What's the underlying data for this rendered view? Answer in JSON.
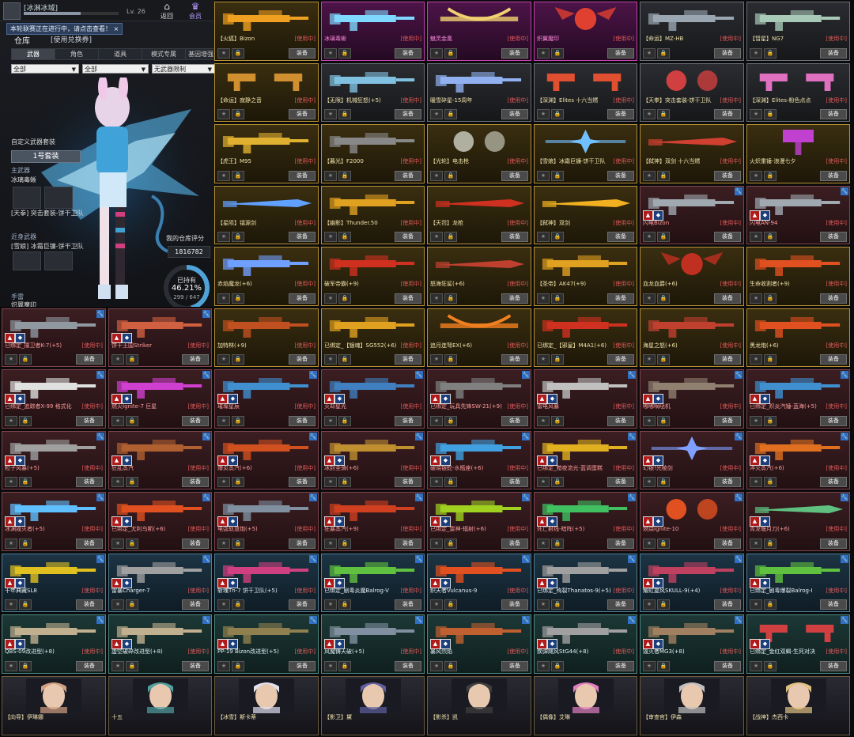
{
  "header": {
    "player_name": "[冰淋冰域]",
    "level": "Lv. 26",
    "back_label": "返回",
    "member_label": "会员",
    "notice": "本轮联赛正在进行中，请点击查看！ ×"
  },
  "warehouse": {
    "title": "仓库",
    "exchange": "[使用兑换券]",
    "tabs": [
      "武器",
      "角色",
      "道具",
      "模式专属",
      "基因增强"
    ],
    "filters": [
      "全部",
      "全部",
      "无武器限制"
    ],
    "custom_set_label": "自定义武器套装",
    "set_button": "1号套装",
    "slots": [
      {
        "slot": "主武器",
        "item": "冰璃毒蜥"
      },
      {
        "slot": "",
        "item": "[天拳] 突击套装-饼干卫队"
      },
      {
        "slot": "近身武器",
        "item": "[雪娘] 冰霜巨镰-饼干卫队"
      },
      {
        "slot": "手雷",
        "item": "炽翼魔印"
      }
    ],
    "score_label": "我的仓库评分",
    "score_value": "1816782",
    "own_label": "已持有",
    "own_percent": 46.21,
    "own_percent_text": "46.21%",
    "own_count": "299 / 647"
  },
  "labels": {
    "using": "[使用中]",
    "equip": "装备",
    "star": "★",
    "lock": "🔒",
    "wrench": "🔧",
    "badge_a": "▲",
    "badge_b": "◆"
  },
  "colors": {
    "gold_frame": "#b89234",
    "pink_frame": "#c540ae",
    "red_frame": "#7e454c",
    "blue_frame": "#4f7f96",
    "teal_frame": "#4d8a82",
    "using_text": "#e35a5a"
  },
  "cards": [
    {
      "name": "【火狐】Bizon",
      "tier": "gold",
      "using": true,
      "shape": "gun",
      "color": "#f0a020"
    },
    {
      "name": "冰璃毒蜥",
      "tier": "pink",
      "using": true,
      "shape": "gun",
      "color": "#7fd8ff"
    },
    {
      "name": "魅灵金凰",
      "tier": "pink",
      "using": true,
      "shape": "bow",
      "color": "#f0d070"
    },
    {
      "name": "炽翼魔印",
      "tier": "pink",
      "using": true,
      "shape": "bug",
      "color": "#e04030"
    },
    {
      "name": "【命运】MZ-HB",
      "tier": "dark",
      "using": true,
      "shape": "gun",
      "color": "#9aa6b2"
    },
    {
      "name": "【彗星】NG7",
      "tier": "dark",
      "using": true,
      "shape": "gun",
      "color": "#a8c8b8"
    },
    {
      "name": "【命运】寂静之音",
      "tier": "gold",
      "using": true,
      "shape": "dual",
      "color": "#d09030"
    },
    {
      "name": "【无限】机械狂怒(+5)",
      "tier": "dark",
      "using": true,
      "shape": "gun",
      "color": "#80c0e0"
    },
    {
      "name": "暖雪碎星-15周年",
      "tier": "dark",
      "using": true,
      "shape": "gun",
      "color": "#90b0f0"
    },
    {
      "name": "【深渊】Elites 十六当燃",
      "tier": "dark",
      "using": true,
      "shape": "dual",
      "color": "#e05030"
    },
    {
      "name": "【天拳】突击套装-饼干卫队",
      "tier": "dark",
      "using": true,
      "shape": "orb",
      "color": "#d04040"
    },
    {
      "name": "【深渊】Elites-粉色点点",
      "tier": "dark",
      "using": true,
      "shape": "dual",
      "color": "#e070c0"
    },
    {
      "name": "【虎王】M95",
      "tier": "gold",
      "using": true,
      "shape": "gun",
      "color": "#e0b030"
    },
    {
      "name": "【暮光】F2000",
      "tier": "gold",
      "using": true,
      "shape": "gun",
      "color": "#888888"
    },
    {
      "name": "【光轮】电击枪",
      "tier": "gold",
      "using": true,
      "shape": "orb",
      "color": "#b0b0a0"
    },
    {
      "name": "【雪娘】冰霜巨镰-饼干卫队",
      "tier": "gold",
      "using": true,
      "shape": "star",
      "color": "#70c0ff"
    },
    {
      "name": "【弑神】双剑 十六当燃",
      "tier": "gold",
      "using": true,
      "shape": "blade",
      "color": "#d04030"
    },
    {
      "name": "火炽重锤-浪漫七夕",
      "tier": "gold",
      "using": true,
      "shape": "hammer",
      "color": "#c040d0"
    },
    {
      "name": "【星陨】镭源剑",
      "tier": "gold",
      "using": true,
      "shape": "blade",
      "color": "#60a0ff"
    },
    {
      "name": "【幽影】Thunder.50",
      "tier": "gold",
      "using": true,
      "shape": "gun",
      "color": "#e0a020"
    },
    {
      "name": "【天罚】龙枪",
      "tier": "gold",
      "using": true,
      "shape": "blade",
      "color": "#d03020"
    },
    {
      "name": "【弑神】双剑",
      "tier": "gold",
      "using": true,
      "shape": "blade",
      "color": "#f0b020"
    },
    {
      "name": "闪电Bizon",
      "tier": "red",
      "using": true,
      "shape": "gun",
      "color": "#a0a8b0"
    },
    {
      "name": "闪电AN-94",
      "tier": "red",
      "using": true,
      "shape": "gun",
      "color": "#a0a8b0"
    },
    {
      "name": "赤焰魔龙(+6)",
      "tier": "gold",
      "using": true,
      "shape": "gun",
      "color": "#70a0ff"
    },
    {
      "name": "破军帝霸(+9)",
      "tier": "gold",
      "using": true,
      "shape": "gun",
      "color": "#d03020"
    },
    {
      "name": "怒海狂鲨(+6)",
      "tier": "gold",
      "using": true,
      "shape": "blade",
      "color": "#c04030"
    },
    {
      "name": "【圣帝】AK47(+9)",
      "tier": "gold",
      "using": true,
      "shape": "gun",
      "color": "#e0a020"
    },
    {
      "name": "血龙血爵(+6)",
      "tier": "gold",
      "using": true,
      "shape": "bug",
      "color": "#c03020"
    },
    {
      "name": "生命收割者(+9)",
      "tier": "gold",
      "using": true,
      "shape": "gun",
      "color": "#e05020"
    },
    {
      "name": "已绑定_撞卫者K-7(+5)",
      "tier": "red",
      "using": true,
      "shape": "gun",
      "color": "#9098a0"
    },
    {
      "name": "饼干王国Striker",
      "tier": "red",
      "using": true,
      "shape": "gun",
      "color": "#d06040"
    },
    {
      "name": "加特林(+9)",
      "tier": "gold",
      "using": true,
      "shape": "gun",
      "color": "#c05020"
    },
    {
      "name": "已绑定_【银魂】SG552(+6)",
      "tier": "gold",
      "using": true,
      "shape": "gun",
      "color": "#e0a020"
    },
    {
      "name": "追月连弩EX(+6)",
      "tier": "gold",
      "using": true,
      "shape": "bow",
      "color": "#f08020"
    },
    {
      "name": "已绑定_【邪皇】M4A1(+6)",
      "tier": "gold",
      "using": true,
      "shape": "gun",
      "color": "#d03020"
    },
    {
      "name": "海星之怒(+6)",
      "tier": "gold",
      "using": true,
      "shape": "gun",
      "color": "#c04030"
    },
    {
      "name": "黑龙炮(+6)",
      "tier": "gold",
      "using": true,
      "shape": "gun",
      "color": "#e05020"
    },
    {
      "name": "已绑定_追踪者X-99 格式化",
      "tier": "red",
      "using": true,
      "shape": "gun",
      "color": "#e0e0e0"
    },
    {
      "name": "燃火Ignite-7 巨星",
      "tier": "red",
      "using": true,
      "shape": "gun",
      "color": "#d040d0"
    },
    {
      "name": "璀璨星辰",
      "tier": "red",
      "using": true,
      "shape": "gun",
      "color": "#4090d0"
    },
    {
      "name": "灭却星光",
      "tier": "red",
      "using": true,
      "shape": "gun",
      "color": "#4080c0"
    },
    {
      "name": "已绑定_玩具先锋SW-21(+9)",
      "tier": "red",
      "using": true,
      "shape": "gun",
      "color": "#808080"
    },
    {
      "name": "雷电风暴",
      "tier": "red",
      "using": true,
      "shape": "gun",
      "color": "#c0c0c0"
    },
    {
      "name": "嘟嘟嘀哒机",
      "tier": "red",
      "using": true,
      "shape": "gun",
      "color": "#908070"
    },
    {
      "name": "已绑定_炽炎汽锤-蓝海(+5)",
      "tier": "red",
      "using": true,
      "shape": "gun",
      "color": "#4090d0"
    },
    {
      "name": "粒子风暴(+5)",
      "tier": "red",
      "using": true,
      "shape": "gun",
      "color": "#a0a0a0"
    },
    {
      "name": "狂乱蒸汽",
      "tier": "red",
      "using": true,
      "shape": "gun",
      "color": "#b06030"
    },
    {
      "name": "爆炎蒸汽(+6)",
      "tier": "red",
      "using": true,
      "shape": "gun",
      "color": "#d05020"
    },
    {
      "name": "冰封圣骑(+6)",
      "tier": "red",
      "using": true,
      "shape": "gun",
      "color": "#c09030"
    },
    {
      "name": "破晓银蛇-水瓶座(+6)",
      "tier": "red",
      "using": true,
      "shape": "gun",
      "color": "#40a0e0"
    },
    {
      "name": "已绑定_黯夜流光-蓝调蛋糕",
      "tier": "red",
      "using": true,
      "shape": "gun",
      "color": "#e0b020"
    },
    {
      "name": "幻银!光棱剑",
      "tier": "red",
      "using": true,
      "shape": "star",
      "color": "#80a0ff"
    },
    {
      "name": "淬火蒸汽(+6)",
      "tier": "red",
      "using": true,
      "shape": "gun",
      "color": "#e07020"
    },
    {
      "name": "冰渊毁灭者(+5)",
      "tier": "red",
      "using": true,
      "shape": "gun",
      "color": "#60c0ff"
    },
    {
      "name": "已绑定_尤利乌斯(+6)",
      "tier": "red",
      "using": true,
      "shape": "gun",
      "color": "#e05020"
    },
    {
      "name": "电弧轨道炮(+5)",
      "tier": "red",
      "using": true,
      "shape": "gun",
      "color": "#8090a0"
    },
    {
      "name": "狂暴蒸汽(+9)",
      "tier": "red",
      "using": true,
      "shape": "gun",
      "color": "#d04020"
    },
    {
      "name": "已绑定_雷神-辐射(+6)",
      "tier": "red",
      "using": true,
      "shape": "gun",
      "color": "#a0d020"
    },
    {
      "name": "死亡射线-暗阵(+5)",
      "tier": "red",
      "using": true,
      "shape": "gun",
      "color": "#40c060"
    },
    {
      "name": "燃烧Ignite-10",
      "tier": "red",
      "using": true,
      "shape": "orb",
      "color": "#e05020"
    },
    {
      "name": "青龙偃月刀(+6)",
      "tier": "red",
      "using": true,
      "shape": "blade",
      "color": "#60c080"
    },
    {
      "name": "十年典藏SL8",
      "tier": "blue",
      "using": true,
      "shape": "gun",
      "color": "#e0c020"
    },
    {
      "name": "雷暴Charger-7",
      "tier": "blue",
      "using": true,
      "shape": "gun",
      "color": "#a0a0a0"
    },
    {
      "name": "斩魂Tn-7 饼干卫队(+5)",
      "tier": "blue",
      "using": true,
      "shape": "gun",
      "color": "#d04080"
    },
    {
      "name": "已绑定_剧毒炎魔Balrog-V",
      "tier": "blue",
      "using": true,
      "shape": "gun",
      "color": "#60c040"
    },
    {
      "name": "织天者Vulcanus-9",
      "tier": "blue",
      "using": true,
      "shape": "gun",
      "color": "#e05020"
    },
    {
      "name": "已绑定_殉裂Thanatos-9(+5)",
      "tier": "blue",
      "using": true,
      "shape": "gun",
      "color": "#a0a0a0"
    },
    {
      "name": "耀虹旋风SKULL-9(+4)",
      "tier": "blue",
      "using": true,
      "shape": "gun",
      "color": "#c04060"
    },
    {
      "name": "已绑定_剧毒爆裂Balrog-I",
      "tier": "blue",
      "using": true,
      "shape": "gun",
      "color": "#60c040"
    },
    {
      "name": "QBS-09改进型(+8)",
      "tier": "teal",
      "using": true,
      "shape": "gun",
      "color": "#c0b090"
    },
    {
      "name": "虚空破碎改进型(+8)",
      "tier": "teal",
      "using": true,
      "shape": "gun",
      "color": "#c0b090"
    },
    {
      "name": "PP-19 Bizon改进型(+5)",
      "tier": "teal",
      "using": true,
      "shape": "gun",
      "color": "#908050"
    },
    {
      "name": "风魔铸天破(+5)",
      "tier": "teal",
      "using": true,
      "shape": "gun",
      "color": "#8090a0"
    },
    {
      "name": "暴风烈焰",
      "tier": "teal",
      "using": true,
      "shape": "gun",
      "color": "#c06030"
    },
    {
      "name": "疾弹飓风StG44(+8)",
      "tier": "teal",
      "using": true,
      "shape": "gun",
      "color": "#a0a0a0"
    },
    {
      "name": "毁灭者MG3(+8)",
      "tier": "teal",
      "using": true,
      "shape": "gun",
      "color": "#a08060"
    },
    {
      "name": "已绑定_金红双蝎-生死对决",
      "tier": "teal",
      "using": true,
      "shape": "dual",
      "color": "#d04040"
    },
    {
      "name": "【向导】伊琳娜",
      "tier": "char",
      "using": false,
      "shape": "face",
      "color": "#d0a080"
    },
    {
      "name": "十五",
      "tier": "char",
      "using": false,
      "shape": "face",
      "color": "#50a0a0"
    },
    {
      "name": "【冰雪】斯卡蒂",
      "tier": "char",
      "using": false,
      "shape": "face",
      "color": "#e0e0f0"
    },
    {
      "name": "【影卫】黛",
      "tier": "char",
      "using": false,
      "shape": "face",
      "color": "#6060a0"
    },
    {
      "name": "【影杀】凯",
      "tier": "char",
      "using": false,
      "shape": "face",
      "color": "#404040"
    },
    {
      "name": "【偶像】艾琳",
      "tier": "char",
      "using": false,
      "shape": "face",
      "color": "#e080c0"
    },
    {
      "name": "【审查官】伊森",
      "tier": "char",
      "using": false,
      "shape": "face",
      "color": "#c0c0c0"
    },
    {
      "name": "【战神】杰西卡",
      "tier": "char",
      "using": false,
      "shape": "face",
      "color": "#e0c080"
    }
  ]
}
